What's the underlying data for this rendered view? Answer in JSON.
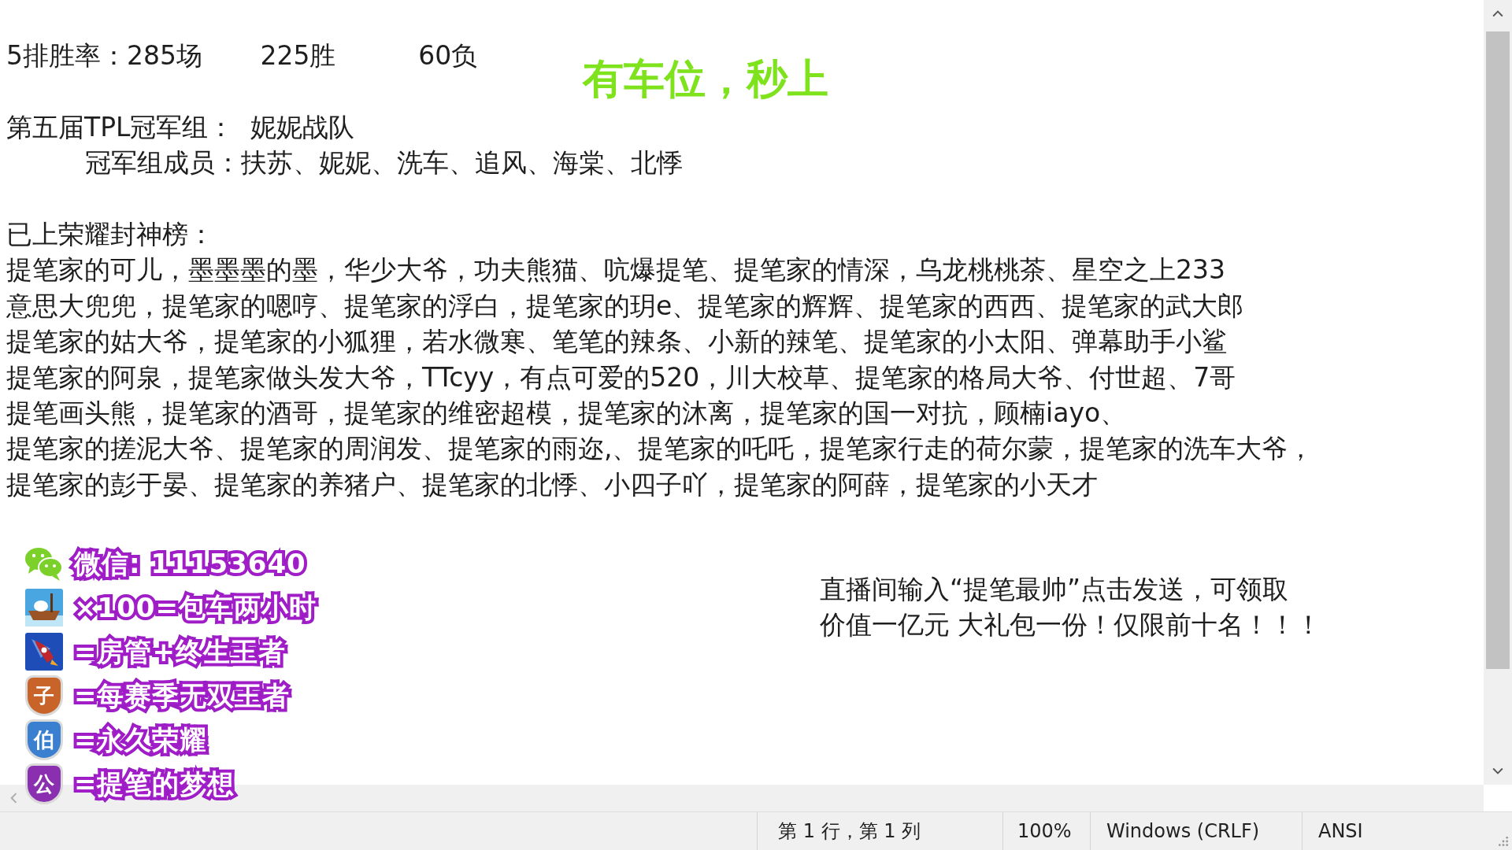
{
  "editor": {
    "paragraphs": [
      [
        {
          "kind": "plain",
          "text": "5排胜率：285场       225胜          60负"
        }
      ],
      [
        {
          "kind": "plain",
          "text": "第五届TPL冠军组：  妮妮战队"
        },
        {
          "kind": "indented",
          "text": "冠军组成员：扶苏、妮妮、洗车、追风、海棠、北悸"
        }
      ],
      [
        {
          "kind": "plain",
          "text": "已上荣耀封神榜："
        },
        {
          "kind": "plain",
          "text": "提笔家的可儿，墨墨墨的墨，华少大爷，功夫熊猫、吭爆提笔、提笔家的情深，乌龙桃桃茶、星空之上233"
        },
        {
          "kind": "plain",
          "text": "意思大兜兜，提笔家的嗯哼、提笔家的浮白，提笔家的玥e、提笔家的辉辉、提笔家的西西、提笔家的武大郎"
        },
        {
          "kind": "plain",
          "text": "提笔家的姑大爷，提笔家的小狐狸，若水微寒、笔笔的辣条、小新的辣笔、提笔家的小太阳、弹幕助手小鲨"
        },
        {
          "kind": "plain",
          "text": "提笔家的阿泉，提笔家做头发大爷，TTcyy，有点可爱的520，川大校草、提笔家的格局大爷、付世超、7哥"
        },
        {
          "kind": "plain",
          "text": "提笔画头熊，提笔家的酒哥，提笔家的维密超模，提笔家的沐离，提笔家的国一对抗，顾楠iayo、"
        },
        {
          "kind": "plain",
          "text": "提笔家的搓泥大爷、提笔家的周润发、提笔家的雨迩,、提笔家的吒吒，提笔家行走的荷尔蒙，提笔家的洗车大爷，"
        },
        {
          "kind": "plain",
          "text": "提笔家的彭于晏、提笔家的养猪户、提笔家的北悸、小四子吖，提笔家的阿薛，提笔家的小天才"
        }
      ]
    ]
  },
  "overlay": {
    "headline": "有车位，秒上",
    "promo": [
      "直播间输入“提笔最帅”点击发送，可领取",
      "价值一亿元 大礼包一份！仅限前十名！！！"
    ],
    "rewards": [
      {
        "kind": "wechat",
        "label": "微信: 11153640"
      },
      {
        "kind": "boat",
        "label": "×100=包车两小时"
      },
      {
        "kind": "rocket",
        "label": "=房管+终生王者"
      },
      {
        "kind": "badge",
        "mark": "子",
        "color": "#c8642a",
        "label": "=每赛季无双王者"
      },
      {
        "kind": "badge",
        "mark": "伯",
        "color": "#3a7fd0",
        "label": "=永久荣耀"
      },
      {
        "kind": "badge",
        "mark": "公",
        "color": "#8a2fb0",
        "label": "=提笔的梦想"
      }
    ]
  },
  "status_bar": {
    "position": "第 1 行，第 1 列",
    "zoom": "100%",
    "line_ending": "Windows (CRLF)",
    "encoding": "ANSI"
  }
}
